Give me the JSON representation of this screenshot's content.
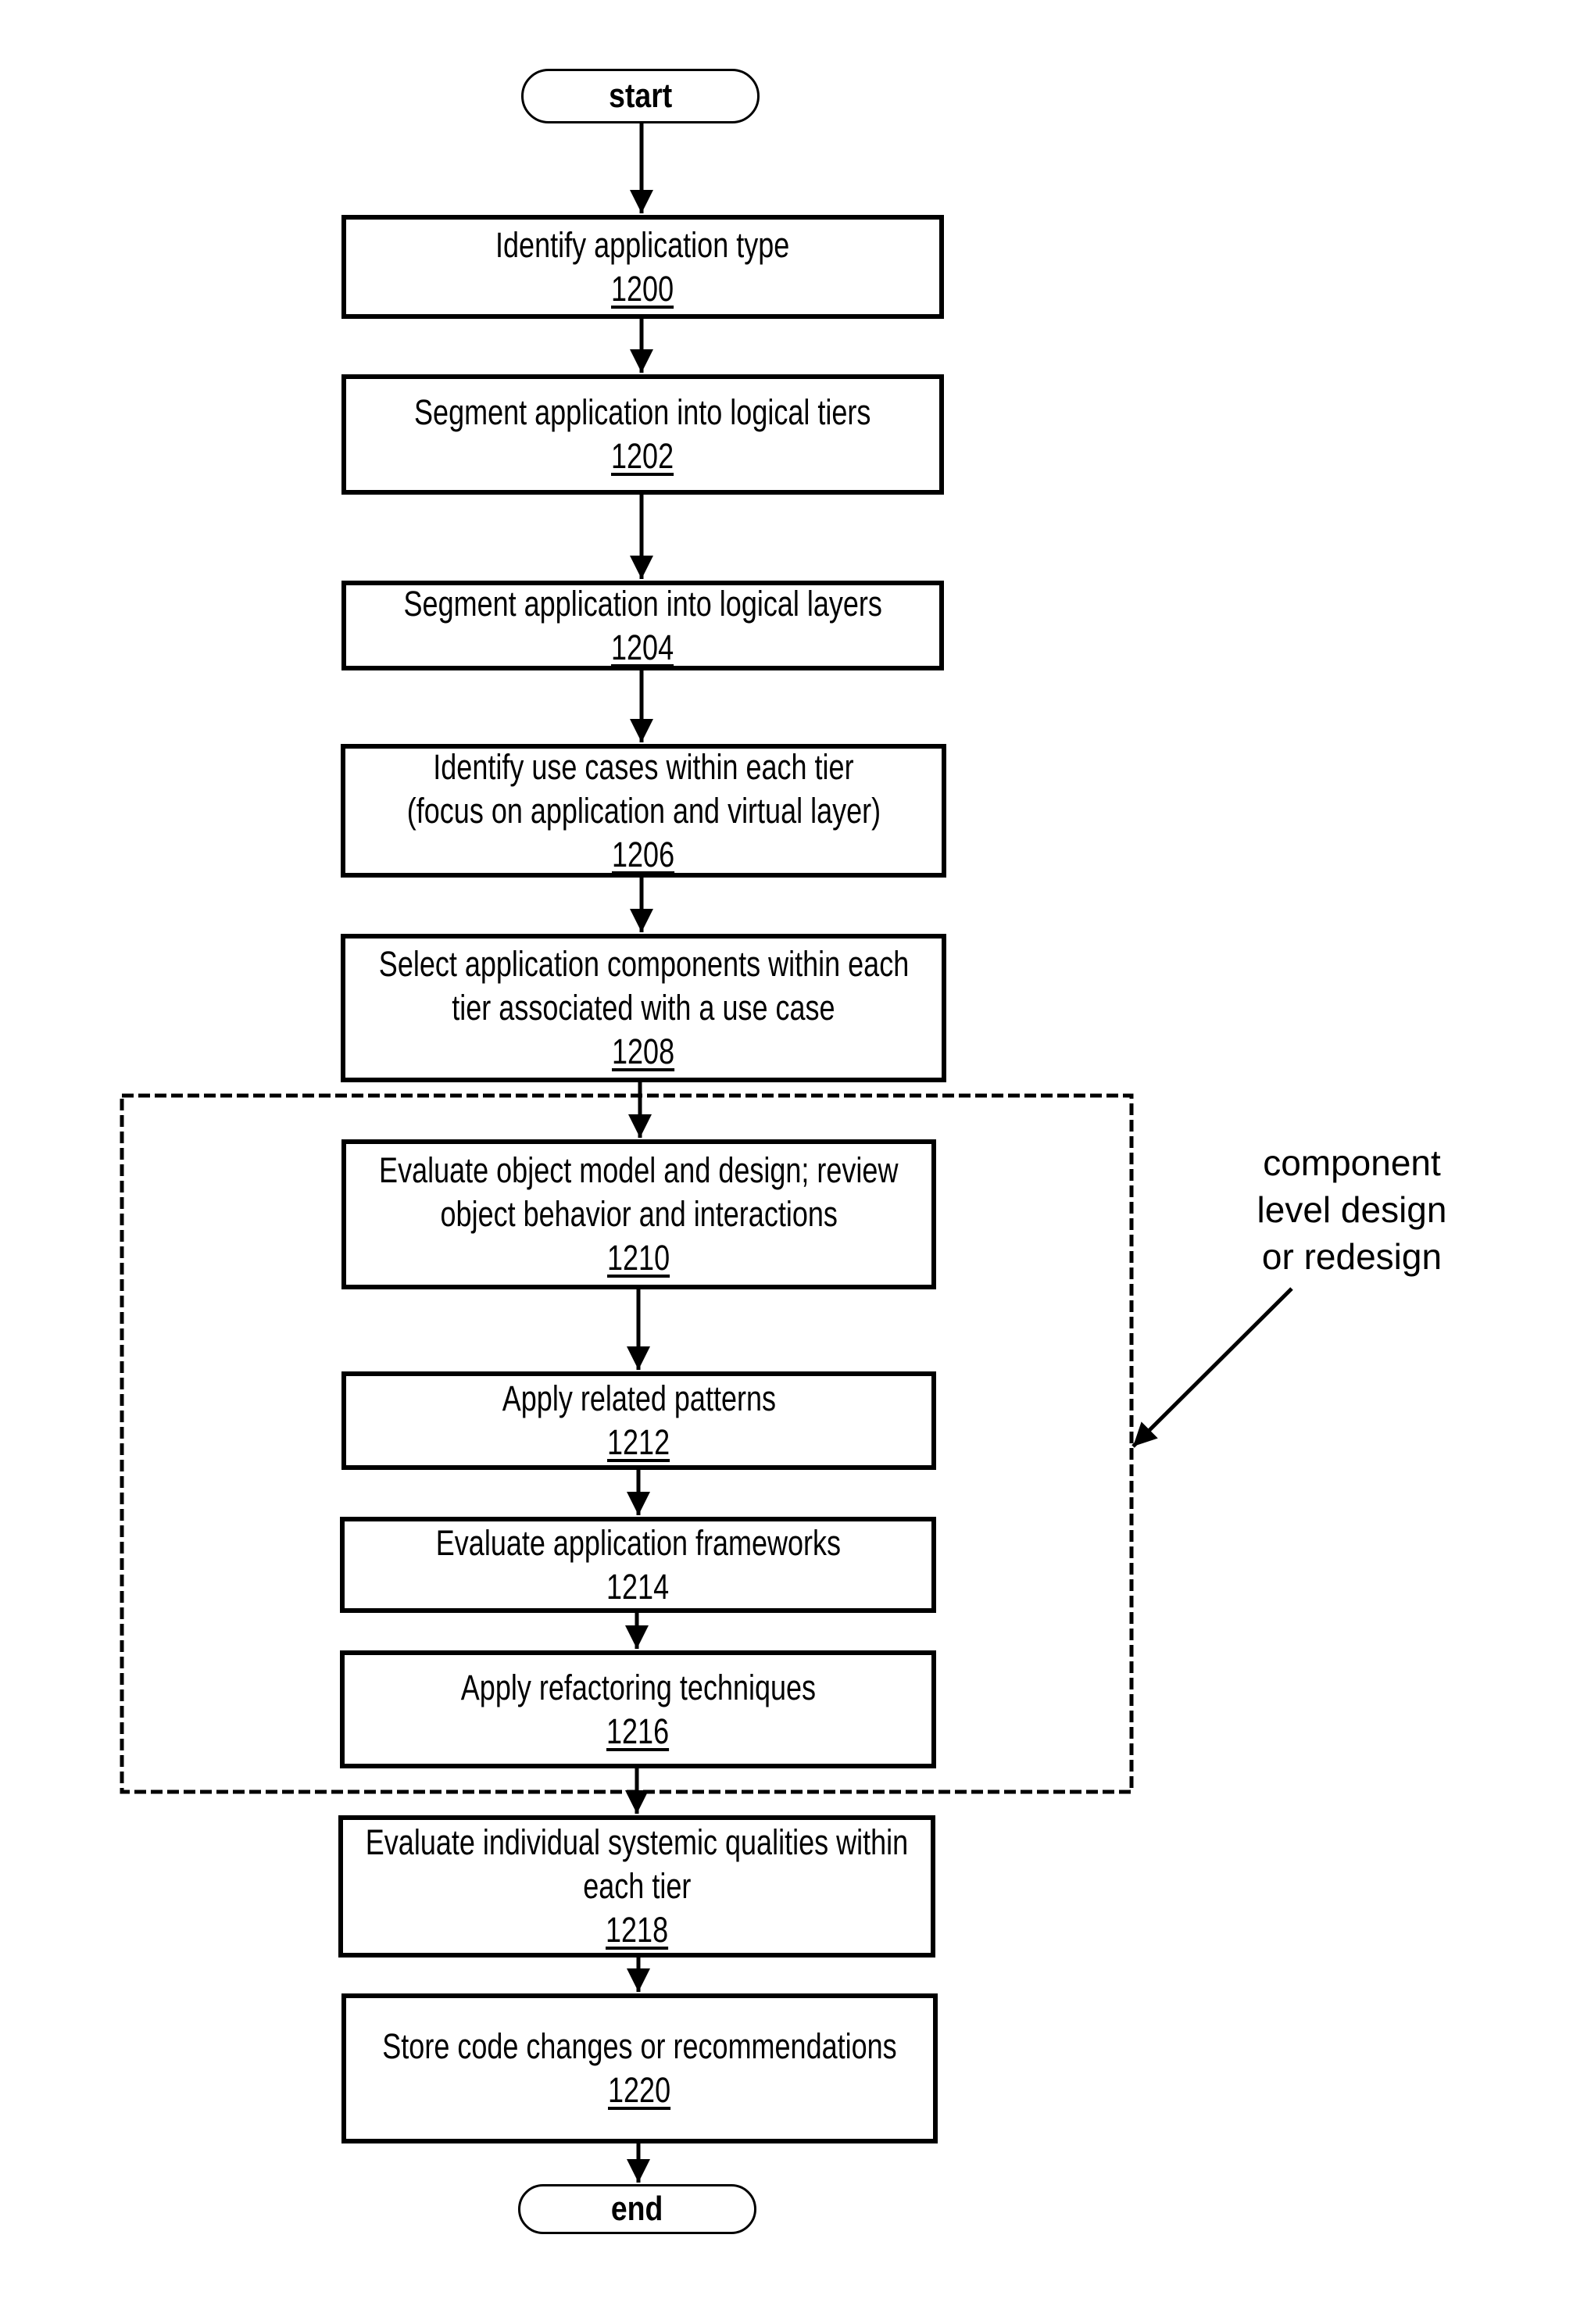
{
  "figure": {
    "terminals": {
      "start": "start",
      "end": "end"
    },
    "steps": [
      {
        "id": "1200",
        "lines": [
          "Identify application type"
        ],
        "ref": "1200",
        "ref_underlined": true
      },
      {
        "id": "1202",
        "lines": [
          "Segment application into logical tiers"
        ],
        "ref": "1202",
        "ref_underlined": true
      },
      {
        "id": "1204",
        "lines": [
          "Segment application into logical layers"
        ],
        "ref": "1204",
        "ref_underlined": true
      },
      {
        "id": "1206",
        "lines": [
          "Identify use cases within each tier",
          "(focus on application and virtual layer)"
        ],
        "ref": "1206",
        "ref_underlined": true
      },
      {
        "id": "1208",
        "lines": [
          "Select application components within each",
          "tier associated with a use case"
        ],
        "ref": "1208",
        "ref_underlined": true
      },
      {
        "id": "1210",
        "lines": [
          "Evaluate object model and design; review",
          "object behavior and interactions"
        ],
        "ref": "1210",
        "ref_underlined": true
      },
      {
        "id": "1212",
        "lines": [
          "Apply related patterns"
        ],
        "ref": "1212",
        "ref_underlined": true
      },
      {
        "id": "1214",
        "lines": [
          "Evaluate application frameworks"
        ],
        "ref": "1214",
        "ref_underlined": false
      },
      {
        "id": "1216",
        "lines": [
          "Apply refactoring techniques"
        ],
        "ref": "1216",
        "ref_underlined": true
      },
      {
        "id": "1218",
        "lines": [
          "Evaluate individual systemic qualities within",
          "each tier"
        ],
        "ref": "1218",
        "ref_underlined": true
      },
      {
        "id": "1220",
        "lines": [
          "Store code changes or recommendations"
        ],
        "ref": "1220",
        "ref_underlined": true
      }
    ],
    "group": {
      "label_lines": [
        "component",
        "level design",
        "or redesign"
      ],
      "contains_steps": [
        "1210",
        "1212",
        "1214",
        "1216"
      ]
    },
    "colors": {
      "ink": "#000000",
      "background": "#ffffff"
    }
  }
}
